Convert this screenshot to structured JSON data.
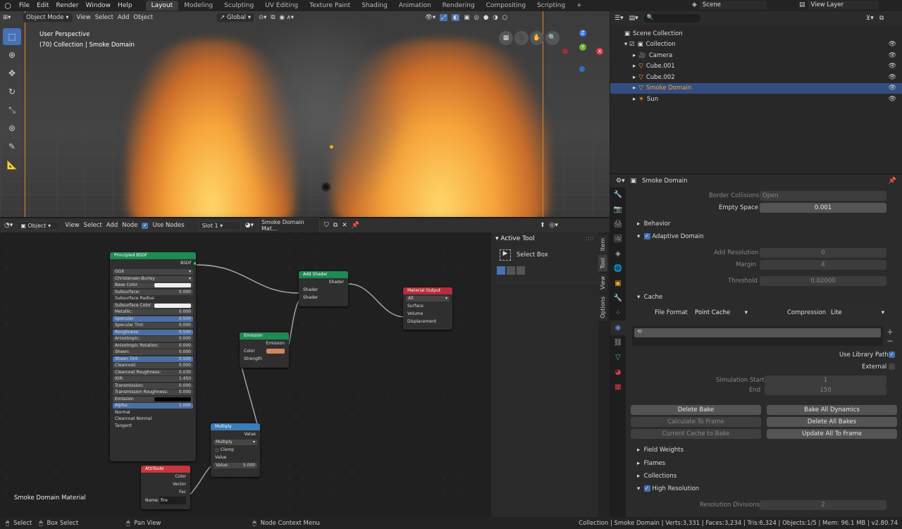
{
  "topbar": {
    "menu": [
      "File",
      "Edit",
      "Render",
      "Window",
      "Help"
    ],
    "workspaces": [
      "Layout",
      "Modeling",
      "Sculpting",
      "UV Editing",
      "Texture Paint",
      "Shading",
      "Animation",
      "Rendering",
      "Compositing",
      "Scripting"
    ],
    "add_tab": "+",
    "scene": "Scene",
    "view_layer": "View Layer"
  },
  "viewport": {
    "mode": "Object Mode",
    "menus": [
      "View",
      "Select",
      "Add",
      "Object"
    ],
    "orientation": "Global",
    "overlay_title": "User Perspective",
    "overlay_sub": "(70) Collection | Smoke Domain",
    "gizmo": {
      "z": "Z",
      "y": "Y",
      "x": "X"
    }
  },
  "node_header": {
    "editor": "Object",
    "menus": [
      "View",
      "Select",
      "Add",
      "Node"
    ],
    "use_nodes": "Use Nodes",
    "slot": "Slot 1",
    "material": "Smoke Domain Mat..."
  },
  "nodes": {
    "bsdf": {
      "title": "Principled BSDF",
      "out": "BSDF",
      "dist": "GGX",
      "sss": "Christensen-Burley",
      "fields": [
        {
          "l": "Base Color",
          "v": "",
          "c": "#f0f0f0"
        },
        {
          "l": "Subsurface:",
          "v": "0.000"
        },
        {
          "l": "Subsurface Radius",
          "v": ""
        },
        {
          "l": "Subsurface Color",
          "v": "",
          "c": "#f0f0f0"
        },
        {
          "l": "Metallic:",
          "v": "0.000"
        },
        {
          "l": "Specular:",
          "v": "0.500",
          "b": 1
        },
        {
          "l": "Specular Tint:",
          "v": "0.000"
        },
        {
          "l": "Roughness:",
          "v": "0.500",
          "b": 1
        },
        {
          "l": "Anisotropic:",
          "v": "0.000"
        },
        {
          "l": "Anisotropic Rotation:",
          "v": "0.000"
        },
        {
          "l": "Sheen:",
          "v": "0.000"
        },
        {
          "l": "Sheen Tint:",
          "v": "0.500",
          "b": 1
        },
        {
          "l": "Clearcoat:",
          "v": "0.000"
        },
        {
          "l": "Clearcoat Roughness:",
          "v": "0.030"
        },
        {
          "l": "IOR:",
          "v": "1.450"
        },
        {
          "l": "Transmission:",
          "v": "0.000"
        },
        {
          "l": "Transmission Roughness:",
          "v": "0.000"
        },
        {
          "l": "Emission",
          "v": "",
          "c": "#000000"
        },
        {
          "l": "Alpha:",
          "v": "1.000",
          "b": 1
        },
        {
          "l": "Normal",
          "v": ""
        },
        {
          "l": "Clearcoat Normal",
          "v": ""
        },
        {
          "l": "Tangent",
          "v": ""
        }
      ]
    },
    "add": {
      "title": "Add Shader",
      "out": "Shader",
      "in1": "Shader",
      "in2": "Shader"
    },
    "output": {
      "title": "Material Output",
      "target": "All",
      "s": "Surface",
      "v": "Volume",
      "d": "Displacement"
    },
    "emission": {
      "title": "Emission",
      "out": "Emission",
      "color": "Color",
      "strength": "Strength"
    },
    "multiply": {
      "title": "Multiply",
      "out": "Value",
      "op": "Multiply",
      "clamp": "Clamp",
      "in": "Value",
      "val_l": "Value:",
      "val": "5.000"
    },
    "attr": {
      "title": "Attribute",
      "o1": "Color",
      "o2": "Vector",
      "o3": "Fac",
      "name_l": "Name:",
      "name": "fire"
    }
  },
  "material_label": "Smoke Domain Material",
  "npanel": {
    "title": "Active Tool",
    "tool": "Select Box",
    "tabs": [
      "Item",
      "Tool",
      "View",
      "Options"
    ]
  },
  "outliner": {
    "root": "Scene Collection",
    "items": [
      {
        "n": "Collection",
        "d": 0
      },
      {
        "n": "Camera",
        "d": 1
      },
      {
        "n": "Cube.001",
        "d": 1
      },
      {
        "n": "Cube.002",
        "d": 1
      },
      {
        "n": "Smoke Domain",
        "d": 1,
        "sel": 1
      },
      {
        "n": "Sun",
        "d": 1
      }
    ]
  },
  "props": {
    "object": "Smoke Domain",
    "border_l": "Border Collisions",
    "border_v": "Open",
    "empty_l": "Empty Space",
    "empty_v": "0.001",
    "behavior": "Behavior",
    "adaptive": "Adaptive Domain",
    "addres_l": "Add Resolution",
    "addres_v": "0",
    "margin_l": "Margin",
    "margin_v": "4",
    "thresh_l": "Threshold",
    "thresh_v": "0.02000",
    "cache": "Cache",
    "ff_l": "File Format",
    "ff_v": "Point Cache",
    "comp_l": "Compression",
    "comp_v": "Lite",
    "uselib": "Use Library Path",
    "external": "External",
    "simstart_l": "Simulation Start",
    "simstart_v": "1",
    "end_l": "End",
    "end_v": "150",
    "btn": {
      "delete_bake": "Delete Bake",
      "bake_all": "Bake All Dynamics",
      "calc_frame": "Calculate To Frame",
      "delete_all": "Delete All Bakes",
      "current_cache": "Current Cache to Bake",
      "update_all": "Update All To Frame"
    },
    "field_weights": "Field Weights",
    "flames": "Flames",
    "collections": "Collections",
    "high_res": "High Resolution",
    "resdiv_l": "Resolution Divisions",
    "resdiv_v": "2"
  },
  "status": {
    "select": "Select",
    "box_select": "Box Select",
    "pan": "Pan View",
    "context": "Node Context Menu",
    "info": "Collection | Smoke Domain | Verts:3,331 | Faces:3,234 | Tris:6,324 | Objects:1/5 | Mem: 96.1 MB | v2.80.74"
  },
  "colors": {
    "accent": "#4772b3",
    "select_orange": "#f5a623",
    "shader_green": "#1f8a53",
    "output_red": "#b52d3a",
    "input_red": "#c8353b",
    "converter_blue": "#3a7cb8"
  }
}
